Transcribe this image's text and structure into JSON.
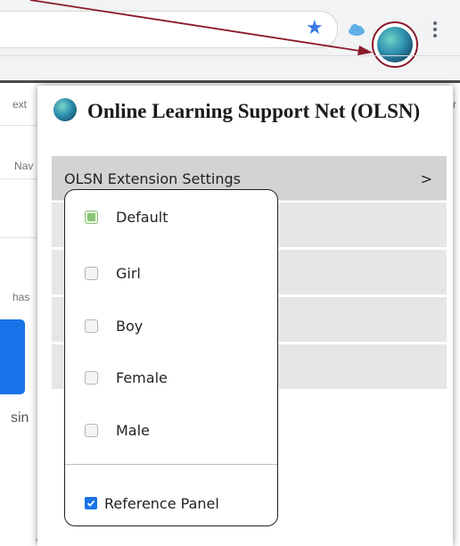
{
  "background": {
    "text_ext": "ext",
    "text_nav": "Nav",
    "text_has": "has",
    "text_sin": "sin",
    "text_r": "r"
  },
  "popup": {
    "title": "Online Learning Support Net (OLSN)",
    "settings_label": "OLSN Extension Settings",
    "settings_arrow": ">"
  },
  "submenu": {
    "options": [
      {
        "label": "Default",
        "selected": true
      },
      {
        "label": "Girl",
        "selected": false
      },
      {
        "label": "Boy",
        "selected": false
      },
      {
        "label": "Female",
        "selected": false
      },
      {
        "label": "Male",
        "selected": false
      }
    ],
    "reference_panel": {
      "label": "Reference Panel",
      "checked": true
    }
  },
  "colors": {
    "accent_blue": "#1a73e8",
    "annotation_red": "#8b1a2b",
    "selected_green": "#89c575"
  },
  "icons": [
    "star-icon",
    "cloud-icon",
    "olsn-globe-icon",
    "kebab-menu-icon",
    "check-icon"
  ]
}
